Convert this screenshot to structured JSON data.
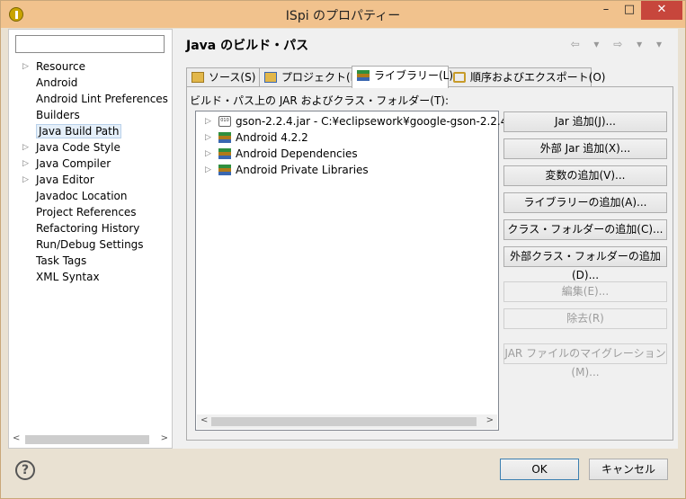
{
  "window": {
    "title": "ISpi のプロパティー",
    "minimize": "–",
    "maximize": "□",
    "close": "✕"
  },
  "left_pane": {
    "filter_value": "",
    "items": [
      {
        "label": "Resource",
        "expandable": true
      },
      {
        "label": "Android",
        "expandable": false
      },
      {
        "label": "Android Lint Preferences",
        "expandable": false
      },
      {
        "label": "Builders",
        "expandable": false
      },
      {
        "label": "Java Build Path",
        "expandable": false,
        "selected": true
      },
      {
        "label": "Java Code Style",
        "expandable": true
      },
      {
        "label": "Java Compiler",
        "expandable": true
      },
      {
        "label": "Java Editor",
        "expandable": true
      },
      {
        "label": "Javadoc Location",
        "expandable": false
      },
      {
        "label": "Project References",
        "expandable": false
      },
      {
        "label": "Refactoring History",
        "expandable": false
      },
      {
        "label": "Run/Debug Settings",
        "expandable": false
      },
      {
        "label": "Task Tags",
        "expandable": false
      },
      {
        "label": "XML Syntax",
        "expandable": false
      }
    ]
  },
  "right_pane": {
    "title": "Java のビルド・パス",
    "nav": "⇦ ▾ ⇨ ▾ ▾",
    "tabs": [
      {
        "label": "ソース(S)"
      },
      {
        "label": "プロジェクト(P)"
      },
      {
        "label": "ライブラリー(L)",
        "active": true
      },
      {
        "label": "順序およびエクスポート(O)"
      }
    ],
    "panel_label": "ビルド・パス上の JAR およびクラス・フォルダー(T):",
    "libraries": [
      {
        "label": "gson-2.2.4.jar - C:¥eclipsework¥google-gson-2.2.4",
        "icon": "jar-icon"
      },
      {
        "label": "Android 4.2.2",
        "icon": "library-icon"
      },
      {
        "label": "Android Dependencies",
        "icon": "library-icon"
      },
      {
        "label": "Android Private Libraries",
        "icon": "library-icon"
      }
    ],
    "buttons": [
      {
        "label": "Jar 追加(J)...",
        "enabled": true
      },
      {
        "label": "外部 Jar 追加(X)...",
        "enabled": true
      },
      {
        "label": "変数の追加(V)...",
        "enabled": true
      },
      {
        "label": "ライブラリーの追加(A)...",
        "enabled": true
      },
      {
        "label": "クラス・フォルダーの追加(C)...",
        "enabled": true
      },
      {
        "label": "外部クラス・フォルダーの追加(D)...",
        "enabled": true
      },
      {
        "label": "編集(E)...",
        "enabled": false
      },
      {
        "label": "除去(R)",
        "enabled": false
      },
      {
        "label": "JAR ファイルのマイグレーション(M)...",
        "enabled": false
      }
    ]
  },
  "footer": {
    "help": "?",
    "ok": "OK",
    "cancel": "キャンセル"
  },
  "arrows": {
    "expand": "▷",
    "left": "<",
    "right": ">"
  }
}
